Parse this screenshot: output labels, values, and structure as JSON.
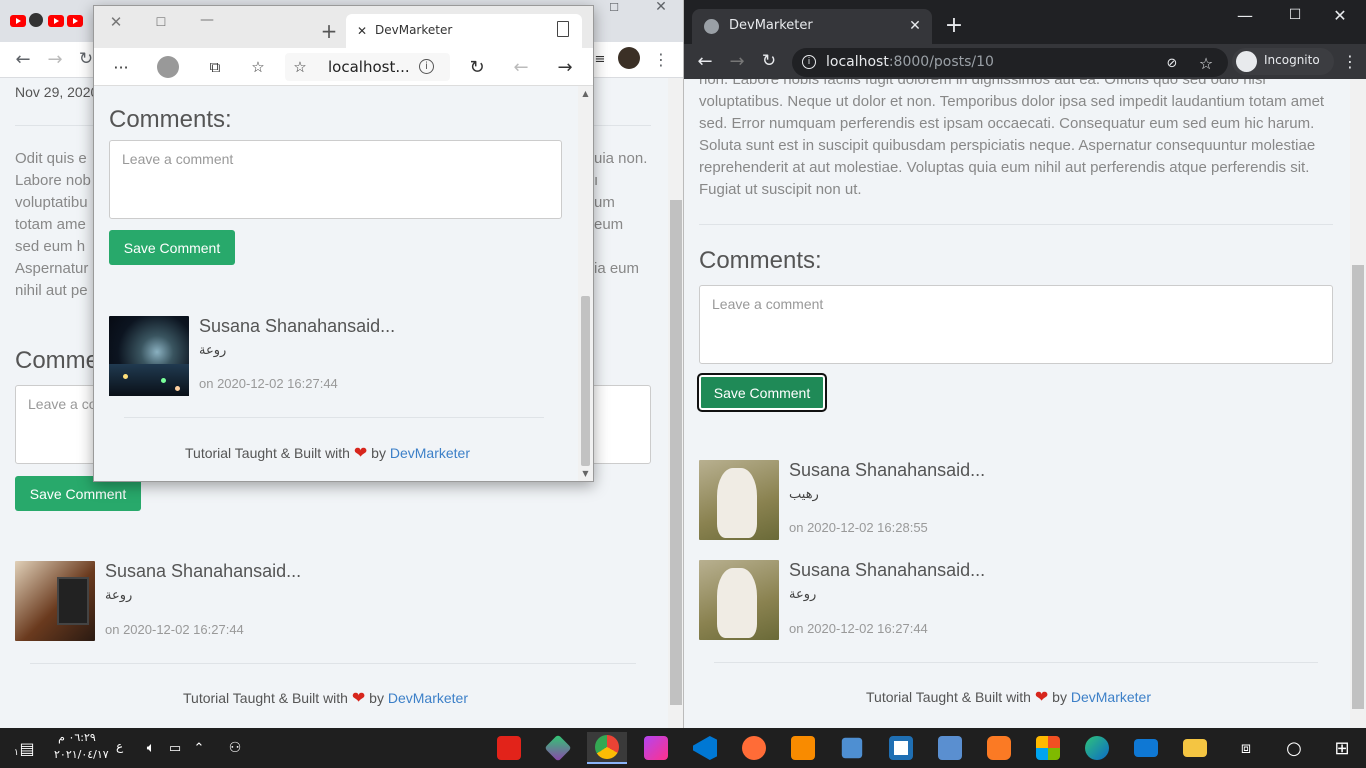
{
  "left_window": {
    "date": "Nov 29, 2020",
    "paragraph_left": "Odit quis e\nLabore nob\nvoluptatibu\ntotam ame\nsed eum h\nAspernatur\nnihil aut pe",
    "paragraph_right": "uia non.\nı\num\neum\n\nia eum",
    "comments_heading": "Comme",
    "comment_placeholder": "Leave a co",
    "save_button": "Save Comment",
    "comment": {
      "name": "Susana Shanahansaid...",
      "text": "روعة",
      "date": "on 2020-12-02 16:27:44"
    },
    "footer": {
      "prefix": "Tutorial Taught & Built with",
      "by": "by",
      "link": "DevMarketer"
    }
  },
  "edge_window": {
    "tab_title": "DevMarketer",
    "address": "localhost...",
    "comments_heading": "Comments:",
    "comment_placeholder": "Leave a comment",
    "save_button": "Save Comment",
    "comment": {
      "name": "Susana Shanahansaid...",
      "text": "روعة",
      "date": "on 2020-12-02 16:27:44"
    },
    "footer": {
      "prefix": "Tutorial Taught & Built with",
      "by": "by",
      "link": "DevMarketer"
    }
  },
  "right_window": {
    "tab_title": "DevMarketer",
    "url_host": "localhost",
    "url_path": ":8000/posts/10",
    "incognito_label": "Incognito",
    "paragraph": "non. Labore nobis facilis fugit dolorem in dignissimos aut ea. Officiis quo sed odio nisi voluptatibus. Neque ut dolor et non. Temporibus dolor ipsa sed impedit laudantium totam amet sed. Error numquam perferendis est ipsam occaecati. Consequatur eum sed eum hic harum. Soluta sunt est in suscipit quibusdam perspiciatis neque. Aspernatur consequuntur molestiae reprehenderit at aut molestiae. Voluptas quia eum nihil aut perferendis atque perferendis sit. Fugiat ut suscipit non ut.",
    "comments_heading": "Comments:",
    "comment_placeholder": "Leave a comment",
    "save_button": "Save Comment",
    "comments": [
      {
        "name": "Susana Shanahansaid...",
        "text": "رهيب",
        "date": "on 2020-12-02 16:28:55"
      },
      {
        "name": "Susana Shanahansaid...",
        "text": "روعة",
        "date": "on 2020-12-02 16:27:44"
      }
    ],
    "footer": {
      "prefix": "Tutorial Taught & Built with",
      "by": "by",
      "link": "DevMarketer"
    }
  },
  "taskbar": {
    "time": "٠٦:٢٩ م",
    "date": "٢٠٢١/٠٤/١٧",
    "lang": "ع",
    "notification_count": "١"
  }
}
